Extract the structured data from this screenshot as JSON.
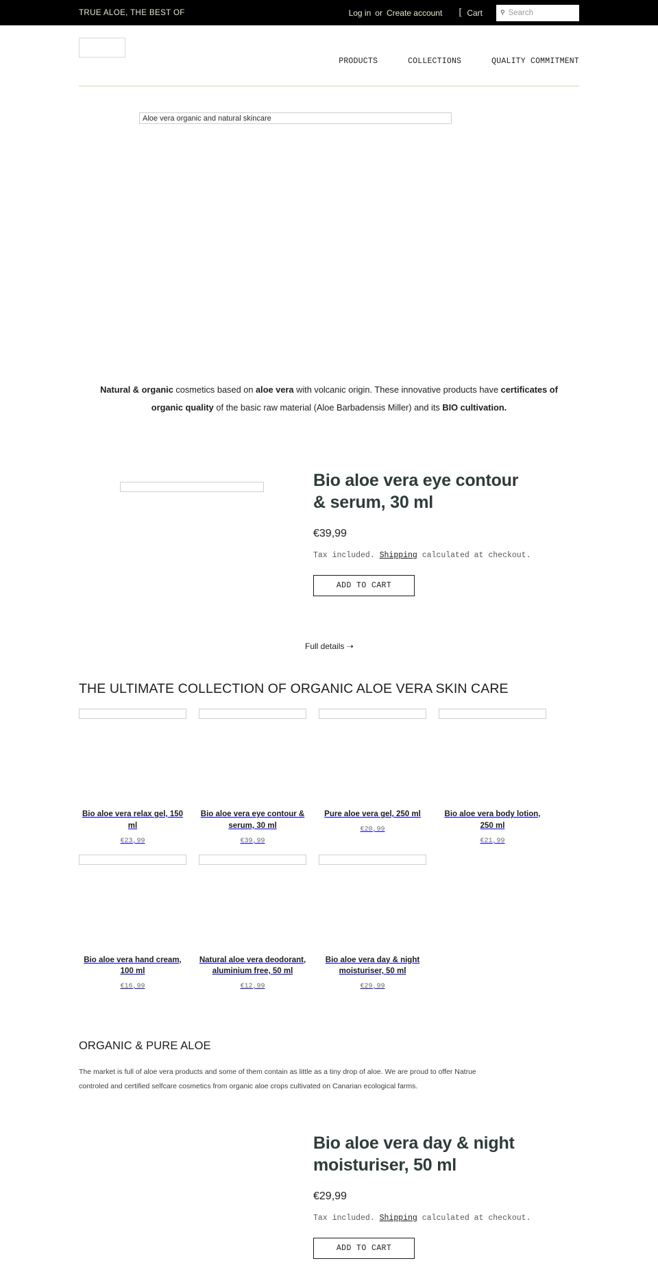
{
  "topbar": {
    "tagline": "TRUE ALOE, THE BEST OF",
    "login_label": "Log in",
    "separator": "or",
    "create_account_label": "Create account",
    "cart_icon": "cart-icon",
    "cart_label": "Cart",
    "search_icon": "search-icon",
    "search_placeholder": "Search",
    "search_value": "",
    "bg_color": "#000000",
    "text_color": "#e9e7cf"
  },
  "header": {
    "logo_alt": "",
    "nav": [
      {
        "label": "PRODUCTS"
      },
      {
        "label": "COLLECTIONS"
      },
      {
        "label": "QUALITY COMMITMENT"
      }
    ],
    "rule_color": "#ddd8a8"
  },
  "hero": {
    "image_alt": "Aloe vera organic and natural skincare"
  },
  "intro": {
    "seg1_bold": "Natural & organic",
    "seg2": " cosmetics based on ",
    "seg3_bold": "aloe vera",
    "seg4": " with volcanic origin. These innovative products have ",
    "seg5_bold": "certificates of organic quality",
    "seg6": " of the basic raw material (Aloe Barbadensis Miller) and its ",
    "seg7_bold": "BIO cultivation."
  },
  "featured_top": {
    "image_alt": "",
    "title": "Bio aloe vera eye contour & serum, 30 ml",
    "price": "€39,99",
    "tax_prefix": "Tax included. ",
    "tax_link": "Shipping",
    "tax_suffix": " calculated at checkout.",
    "add_to_cart_label": "ADD TO CART",
    "full_details_label": "Full details ➝"
  },
  "collection": {
    "heading": "THE ULTIMATE COLLECTION OF ORGANIC ALOE VERA SKIN CARE",
    "row1": [
      {
        "title": "Bio aloe vera relax gel, 150 ml",
        "price": "€23,99",
        "image_alt": ""
      },
      {
        "title": "Bio aloe vera eye contour & serum, 30 ml",
        "price": "€39,99",
        "image_alt": ""
      },
      {
        "title": "Pure aloe vera gel, 250 ml",
        "price": "€20,99",
        "image_alt": ""
      },
      {
        "title": "Bio aloe vera body lotion, 250 ml",
        "price": "€21,99",
        "image_alt": ""
      }
    ],
    "row2": [
      {
        "title": "Bio aloe vera hand cream, 100 ml",
        "price": "€16,99",
        "image_alt": ""
      },
      {
        "title": "Natural aloe vera deodorant, aluminium free, 50 ml",
        "price": "€12,99",
        "image_alt": ""
      },
      {
        "title": "Bio aloe vera day & night moisturiser, 50 ml",
        "price": "€29,99",
        "image_alt": ""
      }
    ]
  },
  "organic": {
    "heading": "ORGANIC & PURE ALOE",
    "body": "The market is full of aloe vera products and some of them contain as little as a tiny drop of aloe. We are proud to offer Natrue controled and certified selfcare cosmetics from organic aloe crops cultivated on Canarian ecological farms."
  },
  "featured_bottom": {
    "image_alt": "",
    "title": "Bio aloe vera day & night moisturiser, 50 ml",
    "price": "€29,99",
    "tax_prefix": "Tax included. ",
    "tax_link": "Shipping",
    "tax_suffix": " calculated at checkout.",
    "add_to_cart_label": "ADD TO CART"
  }
}
